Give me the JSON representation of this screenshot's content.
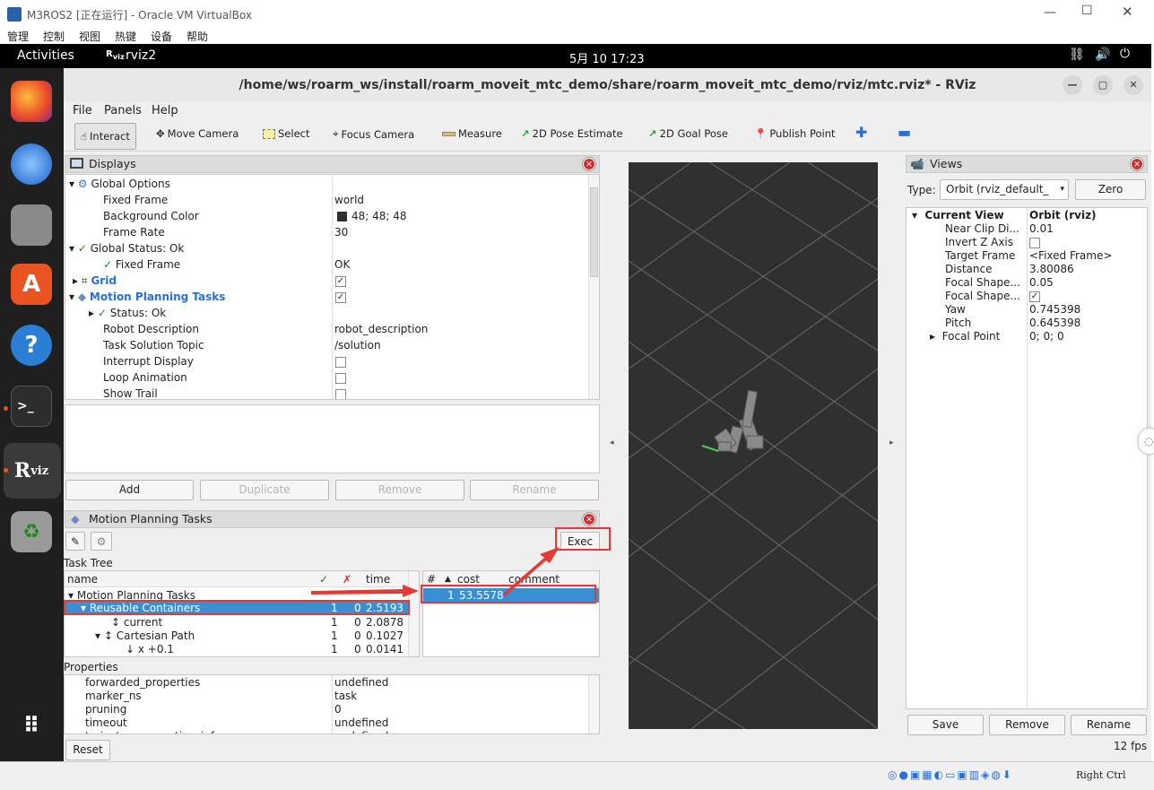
{
  "vbox": {
    "title": "M3ROS2 [正在运行] - Oracle VM VirtualBox",
    "menu": [
      "管理",
      "控制",
      "视图",
      "热键",
      "设备",
      "帮助"
    ],
    "host_key": "Right Ctrl"
  },
  "topbar": {
    "activities": "Activities",
    "app": "rviz2",
    "clock": "5月 10  17:23"
  },
  "rviz": {
    "title": "/home/ws/roarm_ws/install/roarm_moveit_mtc_demo/share/roarm_moveit_mtc_demo/rviz/mtc.rviz* - RViz",
    "menu": [
      "File",
      "Panels",
      "Help"
    ],
    "tools": [
      "Interact",
      "Move Camera",
      "Select",
      "Focus Camera",
      "Measure",
      "2D Pose Estimate",
      "2D Goal Pose",
      "Publish Point"
    ],
    "fps": "12 fps"
  },
  "displays": {
    "title": "Displays",
    "rows": [
      {
        "name": "Global Options",
        "value": ""
      },
      {
        "name": "Fixed Frame",
        "value": "world"
      },
      {
        "name": "Background Color",
        "value": "48; 48; 48"
      },
      {
        "name": "Frame Rate",
        "value": "30"
      },
      {
        "name": "Global Status: Ok",
        "value": ""
      },
      {
        "name": "Fixed Frame",
        "value": "OK"
      },
      {
        "name": "Grid",
        "value": ""
      },
      {
        "name": "Motion Planning Tasks",
        "value": ""
      },
      {
        "name": "Status: Ok",
        "value": ""
      },
      {
        "name": "Robot Description",
        "value": "robot_description"
      },
      {
        "name": "Task Solution Topic",
        "value": "/solution"
      },
      {
        "name": "Interrupt Display",
        "value": ""
      },
      {
        "name": "Loop Animation",
        "value": ""
      },
      {
        "name": "Show Trail",
        "value": ""
      }
    ],
    "buttons": [
      "Add",
      "Duplicate",
      "Remove",
      "Rename"
    ]
  },
  "mpt": {
    "title": "Motion Planning Tasks",
    "exec": "Exec",
    "task_tree_label": "Task Tree",
    "columns": [
      "name",
      "✓",
      "✗",
      "time"
    ],
    "rows": [
      {
        "name": "Motion Planning Tasks",
        "ok": "",
        "fail": "",
        "time": ""
      },
      {
        "name": "Reusable Containers",
        "ok": "1",
        "fail": "0",
        "time": "2.5193"
      },
      {
        "name": "current",
        "ok": "1",
        "fail": "0",
        "time": "2.0878"
      },
      {
        "name": "Cartesian Path",
        "ok": "1",
        "fail": "0",
        "time": "0.1027"
      },
      {
        "name": "x +0.1",
        "ok": "1",
        "fail": "0",
        "time": "0.0141"
      }
    ],
    "sol_columns": [
      "#",
      "cost",
      "comment"
    ],
    "solutions": [
      {
        "id": "1",
        "cost": "53.5578",
        "comment": ""
      }
    ],
    "properties_label": "Properties",
    "properties": [
      {
        "name": "forwarded_properties",
        "value": "undefined"
      },
      {
        "name": "marker_ns",
        "value": "task"
      },
      {
        "name": "pruning",
        "value": "0"
      },
      {
        "name": "timeout",
        "value": "undefined"
      },
      {
        "name": "trajectory_execution_info",
        "value": "undefined"
      }
    ],
    "reset": "Reset"
  },
  "views": {
    "title": "Views",
    "type_label": "Type:",
    "type_value": "Orbit (rviz_default_",
    "zero": "Zero",
    "header_name": "Current View",
    "header_value": "Orbit (rviz)",
    "rows": [
      {
        "name": "Near Clip Di...",
        "value": "0.01"
      },
      {
        "name": "Invert Z Axis",
        "value": ""
      },
      {
        "name": "Target Frame",
        "value": "<Fixed Frame>"
      },
      {
        "name": "Distance",
        "value": "3.80086"
      },
      {
        "name": "Focal Shape...",
        "value": "0.05"
      },
      {
        "name": "Focal Shape...",
        "value": ""
      },
      {
        "name": "Yaw",
        "value": "0.745398"
      },
      {
        "name": "Pitch",
        "value": "0.645398"
      },
      {
        "name": "Focal Point",
        "value": "0; 0; 0"
      }
    ],
    "buttons": [
      "Save",
      "Remove",
      "Rename"
    ]
  },
  "colors": {
    "accent": "#3a8fd0",
    "highlight": "#e53935",
    "viewport": "#303030",
    "dock": "#1f1f1f"
  }
}
